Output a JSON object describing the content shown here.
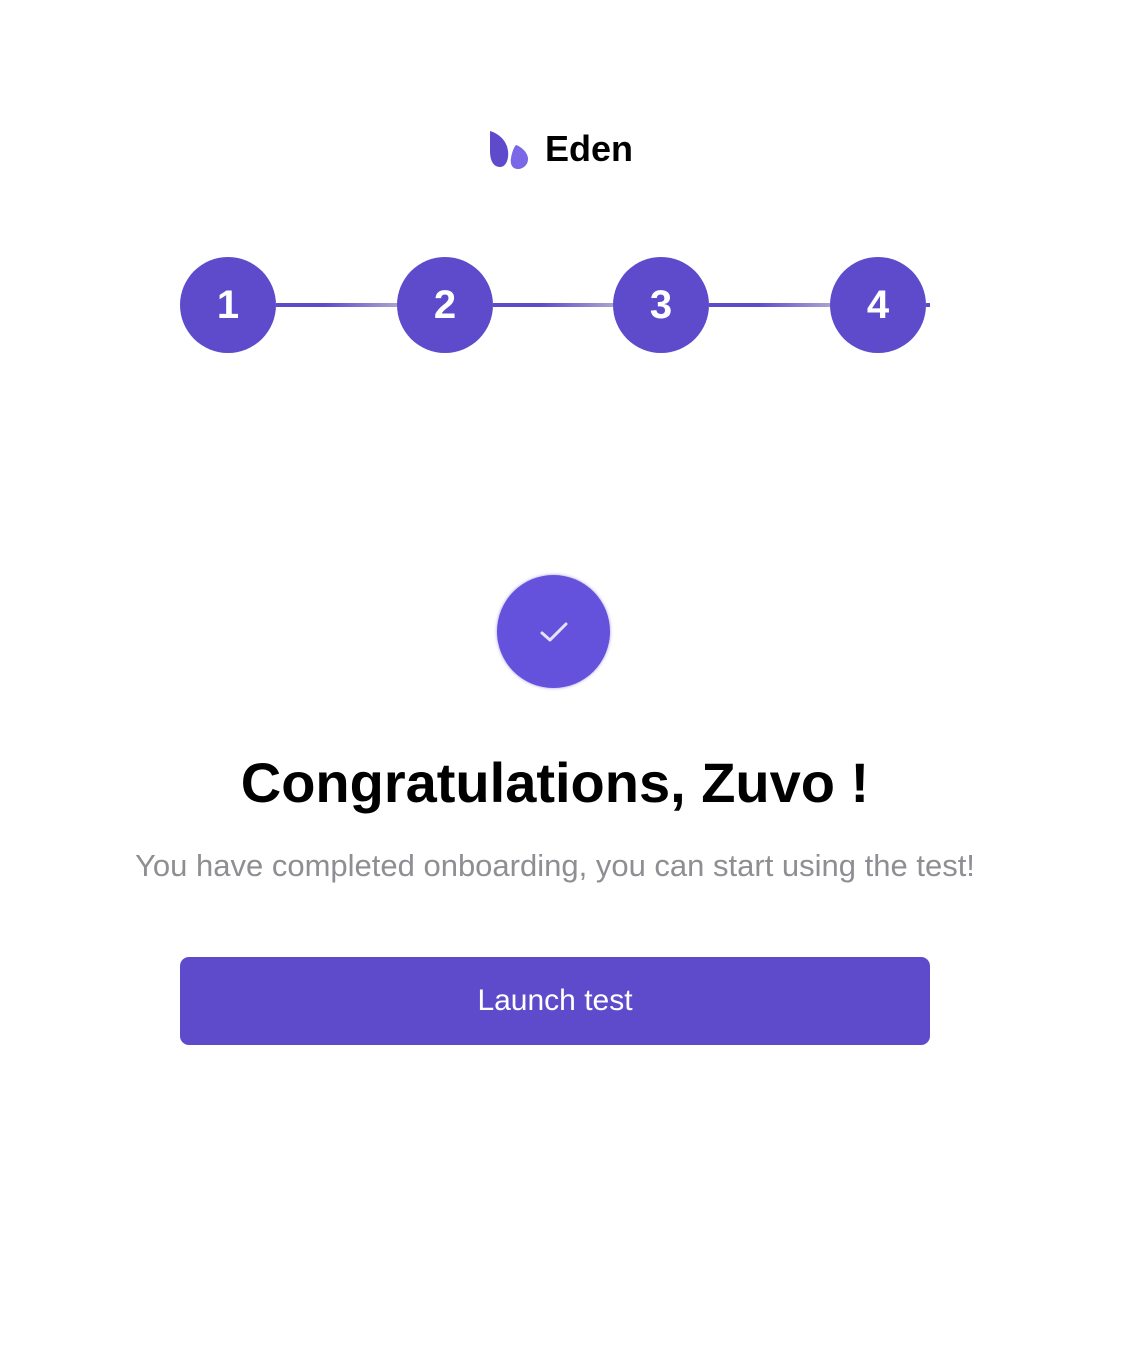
{
  "brand": {
    "name": "Eden",
    "logo_icon": "eden-leaf-logo-icon",
    "accent_color": "#5d4bcc"
  },
  "stepper": {
    "steps": [
      {
        "label": "1"
      },
      {
        "label": "2"
      },
      {
        "label": "3"
      },
      {
        "label": "4"
      }
    ],
    "current_step": 4,
    "color": "#5d4bcc"
  },
  "completion": {
    "icon": "checkmark-icon",
    "badge_color": "#6451dc",
    "title": "Congratulations, Zuvo !",
    "subtitle": "You have completed onboarding, you can start using the test!"
  },
  "actions": {
    "launch_label": "Launch test"
  }
}
